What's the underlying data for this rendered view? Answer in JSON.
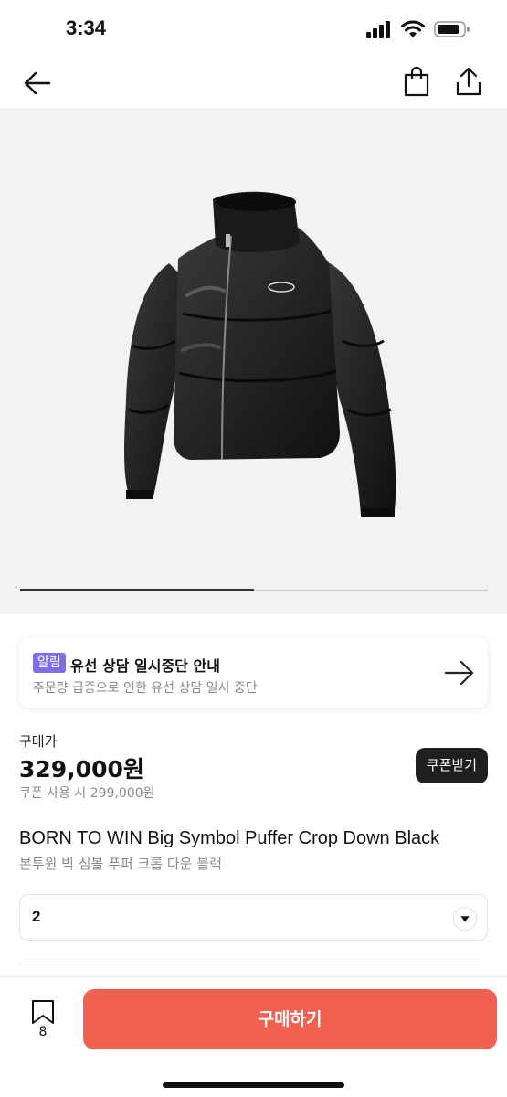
{
  "status_bar": {
    "time": "3:34"
  },
  "nav": {
    "back_icon": "arrow-left-icon",
    "cart_icon": "shopping-bag-icon",
    "share_icon": "share-icon"
  },
  "hero": {
    "image": "black cropped puffer jacket product photo",
    "gallery_progress": 0.5
  },
  "notice": {
    "badge": "알림",
    "title": "유선 상담 일시중단 안내",
    "subtitle": "주문량 급증으로 인한 유선 상담 일시 중단",
    "arrow_icon": "arrow-right-icon"
  },
  "price": {
    "label": "구매가",
    "value": "329,000원",
    "coupon_price": "쿠폰 사용 시 299,000원",
    "coupon_button": "쿠폰받기"
  },
  "product": {
    "name": "BORN TO WIN Big Symbol Puffer Crop Down Black",
    "name_ko": "본투윈 빅 심볼 푸퍼 크롭 다운 블랙"
  },
  "quantity_select": {
    "value": "2",
    "icon": "chevron-down-icon"
  },
  "bottom_bar": {
    "bookmark_count": "8",
    "bookmark_icon": "bookmark-icon",
    "buy_label": "구매하기"
  },
  "colors": {
    "buy_button": "#f06152",
    "badge": "#7c6ee6",
    "coupon_button": "#1f1f1f"
  }
}
